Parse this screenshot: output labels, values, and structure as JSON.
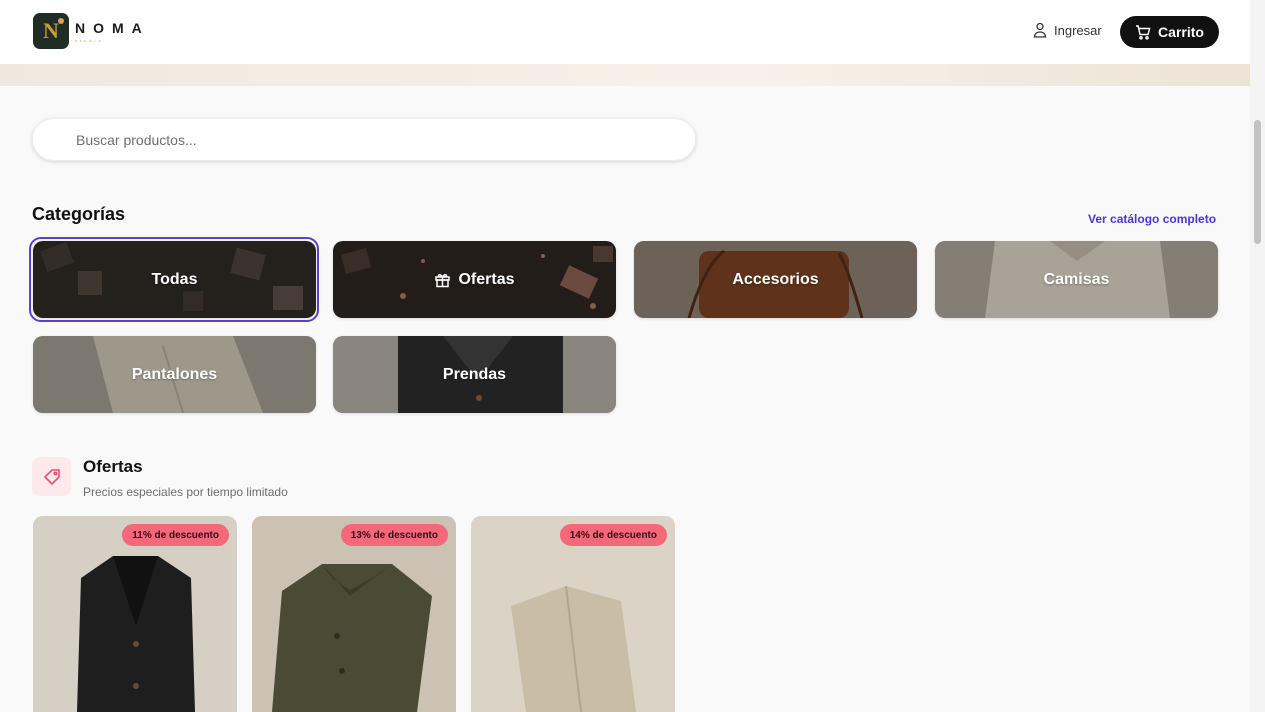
{
  "header": {
    "brand": "NOMA",
    "brand_sub": "studio",
    "login_label": "Ingresar",
    "cart_label": "Carrito"
  },
  "search": {
    "placeholder": "Buscar productos..."
  },
  "categories": {
    "title": "Categorías",
    "catalog_link": "Ver catálogo completo",
    "items": [
      {
        "label": "Todas",
        "selected": true
      },
      {
        "label": "Ofertas",
        "icon": "gift-icon"
      },
      {
        "label": "Accesorios"
      },
      {
        "label": "Camisas"
      },
      {
        "label": "Pantalones"
      },
      {
        "label": "Prendas"
      }
    ]
  },
  "offers": {
    "title": "Ofertas",
    "subtitle": "Precios especiales por tiempo limitado",
    "icon": "tag-icon",
    "products": [
      {
        "badge": "11% de descuento"
      },
      {
        "badge": "13% de descuento"
      },
      {
        "badge": "14% de descuento"
      }
    ]
  },
  "colors": {
    "accent": "#4a36d3",
    "badge": "#f4687a",
    "cart_button": "#111111"
  }
}
